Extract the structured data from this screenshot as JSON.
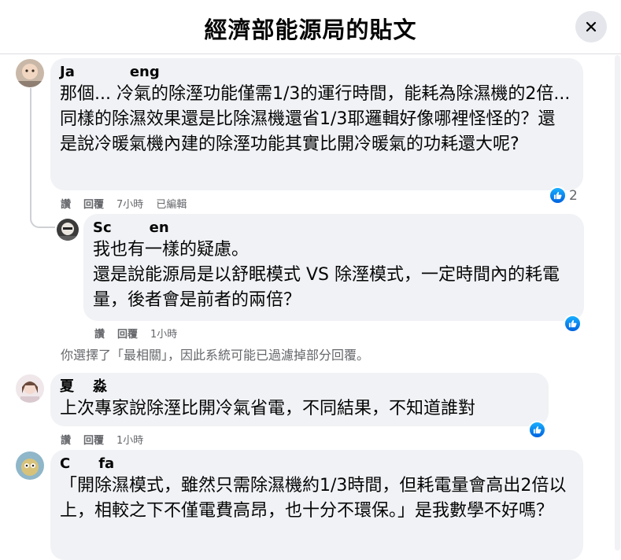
{
  "header": {
    "title": "經濟部能源局的貼文"
  },
  "comments": [
    {
      "name": "Ja eng",
      "name_visible_start": "Ja",
      "name_visible_end": "eng",
      "text": "那個... 冷氣的除溼功能僅需1/3的運行時間，能耗為除濕機的2倍... 同樣的除濕效果還是比除濕機還省1/3耶邏輯好像哪裡怪怪的？還是說冷暖氣機內建的除溼功能其實比開冷暖氣的功耗還大呢?",
      "actions": {
        "like": "讚",
        "reply": "回覆",
        "time": "7小時",
        "edited": "已編輯"
      },
      "reactions": {
        "count": "2"
      }
    },
    {
      "name": "Sc en",
      "name_visible_start": "Sc",
      "name_visible_end": "en",
      "text_lines": [
        "我也有一樣的疑慮。",
        "還是說能源局是以舒眠模式 VS 除溼模式，一定時間內的耗電量，後者會是前者的兩倍？"
      ],
      "actions": {
        "like": "讚",
        "reply": "回覆",
        "time": "1小時"
      }
    },
    {
      "name": "夏 淼",
      "name_visible_start": "夏",
      "name_visible_end": "淼",
      "text": "上次專家說除溼比開冷氣省電，不同結果，不知道誰對",
      "actions": {
        "like": "讚",
        "reply": "回覆",
        "time": "1小時"
      }
    },
    {
      "name": "C fa",
      "name_visible_start": "C",
      "name_visible_end": "fa",
      "text": "「開除濕模式，雖然只需除濕機約1/3時間，但耗電量會高出2倍以上，相較之下不僅電費高昂，也十分不環保。」是我數學不好嗎？"
    }
  ],
  "notice": "你選擇了「最相關」，因此系統可能已過濾掉部分回覆。",
  "colors": {
    "bubble": "#f0f2f5",
    "meta": "#65676b",
    "like_blue": "#1877f2"
  },
  "icons": {
    "close": "close-icon",
    "like": "thumbs-up-icon"
  }
}
